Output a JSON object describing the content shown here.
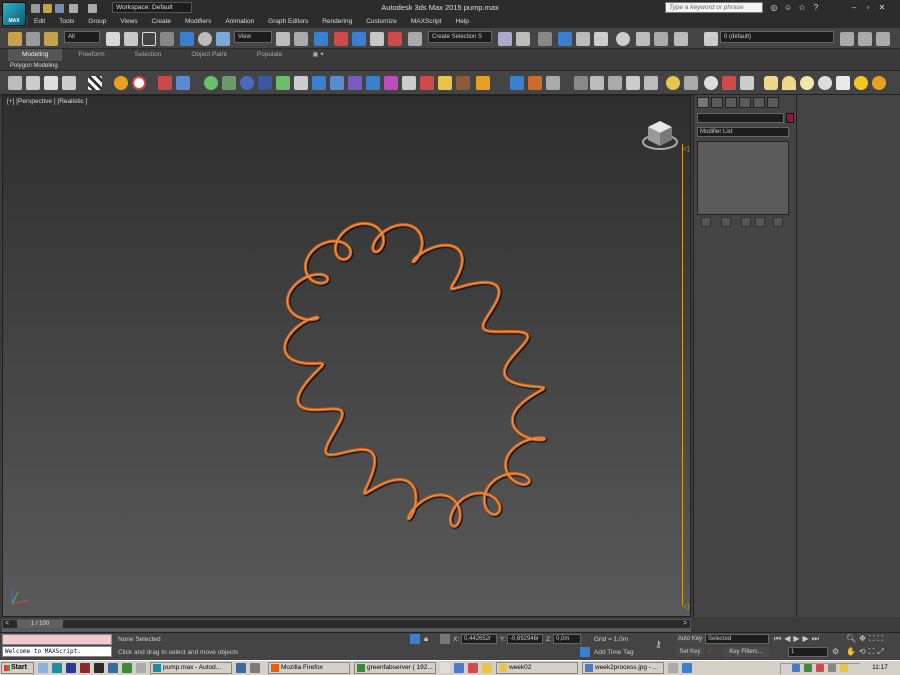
{
  "titlebar": {
    "app_title": "Autodesk 3ds Max 2015     pump.max",
    "workspace_label": "Workspace: Default",
    "search_placeholder": "Type a keyword or phrase",
    "logo_text": "MAX"
  },
  "menu": [
    "Edit",
    "Tools",
    "Group",
    "Views",
    "Create",
    "Modifiers",
    "Animation",
    "Graph Editors",
    "Rendering",
    "Customize",
    "MAXScript",
    "Help"
  ],
  "main_toolbar": {
    "filter_dropdown": "All",
    "coord_dropdown": "View",
    "selection_set": "Create Selection S",
    "layer_dropdown": "0 (default)"
  },
  "ribbon": {
    "tabs": [
      "Modeling",
      "Freeform",
      "Selection",
      "Object Paint",
      "Populate"
    ],
    "active_tab": "Modeling",
    "panel_label": "Polygon Modeling"
  },
  "viewport": {
    "label": "[+] [Perspective ] [Realistic ]",
    "object_color": "#c8641e",
    "background_top": "#2e2e2e",
    "background_bottom": "#5a5a5a"
  },
  "command_panel": {
    "modifier_list": "Modifier List",
    "object_color": "#8c1a3c"
  },
  "time_slider": {
    "label": "1 / 100"
  },
  "status": {
    "maxscript_output": "Welcome to MAXScript.",
    "selection": "None Selected",
    "prompt": "Click and drag to select and move objects",
    "x_label": "X:",
    "x_value": "0,442652r",
    "y_label": "Y:",
    "y_value": "-0,692946r",
    "z_label": "Z:",
    "z_value": "0,0m",
    "grid": "Grid = 1,0m",
    "add_time_tag": "Add Time Tag",
    "auto_key": "Auto Key",
    "set_key": "Set Key",
    "selected_dd": "Selected",
    "key_filters": "Key Filters...",
    "frame": "1"
  },
  "taskbar": {
    "start": "Start",
    "tasks": [
      {
        "label": "pump.max - Autod...",
        "active": true,
        "icon_color": "#1e8aa3"
      },
      {
        "label": "Mozilla Firefox",
        "active": false,
        "icon_color": "#e66000"
      },
      {
        "label": "greenfabserver ( 192...",
        "active": false,
        "icon_color": "#3a8a3a"
      },
      {
        "label": "week02",
        "active": false,
        "icon_color": "#e8c44a"
      },
      {
        "label": "week2process.jpg - ...",
        "active": false,
        "icon_color": "#4a7ac8"
      }
    ],
    "clock": "11:17"
  }
}
